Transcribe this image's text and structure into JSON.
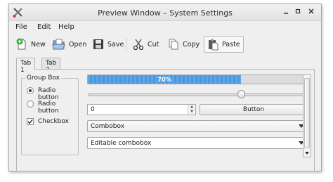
{
  "window": {
    "title": "Preview Window – System Settings",
    "controls": [
      "minimize-icon",
      "maximize-icon",
      "close-icon"
    ]
  },
  "menubar": {
    "items": [
      {
        "label": "File"
      },
      {
        "label": "Edit"
      },
      {
        "label": "Help"
      }
    ]
  },
  "toolbar": {
    "new_label": "New",
    "open_label": "Open",
    "save_label": "Save",
    "cut_label": "Cut",
    "copy_label": "Copy",
    "paste_label": "Paste",
    "icons": [
      "new-document-icon",
      "open-folder-icon",
      "floppy-save-icon",
      "scissors-icon",
      "copy-icon",
      "clipboard-paste-icon"
    ],
    "active_item": "Paste"
  },
  "tabs": [
    {
      "label": "Tab 1",
      "selected": true
    },
    {
      "label": "Tab 2",
      "selected": false
    }
  ],
  "group_box": {
    "title": "Group Box",
    "radio1_label": "Radio button",
    "radio1_checked": true,
    "radio2_label": "Radio button",
    "radio2_checked": false,
    "checkbox_label": "Checkbox",
    "checkbox_checked": true
  },
  "progress": {
    "value": 70,
    "label": "70%"
  },
  "slider": {
    "value_fraction": 0.7
  },
  "spinbox": {
    "value": "0"
  },
  "button": {
    "label": "Button"
  },
  "combobox": {
    "selected": "Combobox"
  },
  "editable_combobox": {
    "value": "Editable combobox"
  },
  "colors": {
    "progress_fill": "#4a98dc",
    "window_bg": "#efefef"
  }
}
